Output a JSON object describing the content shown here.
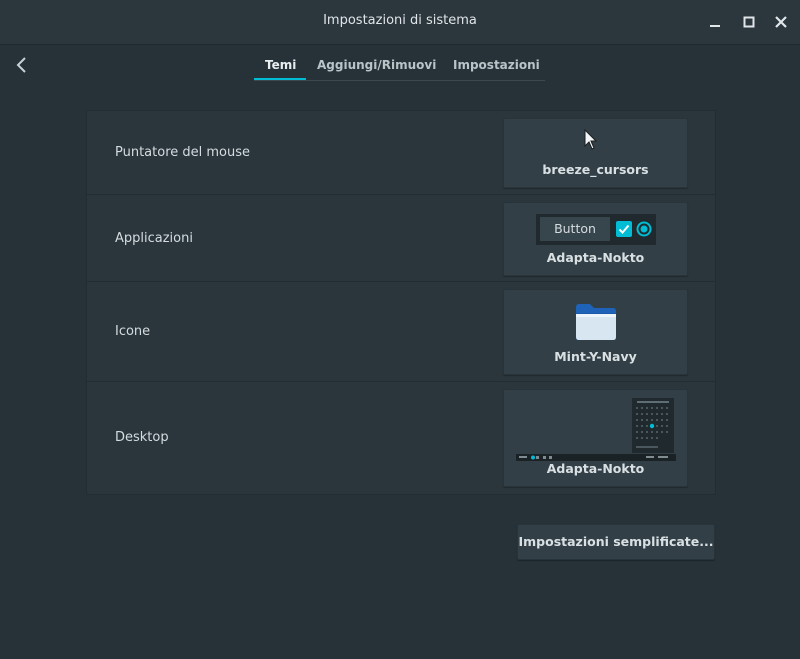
{
  "window": {
    "title": "Impostazioni di sistema",
    "controls": [
      "minimize-icon",
      "maximize-icon",
      "close-icon"
    ]
  },
  "nav": {
    "back_icon": "chevron-left-icon"
  },
  "tabs": [
    {
      "label": "Temi",
      "active": true
    },
    {
      "label": "Aggiungi/Rimuovi",
      "active": false
    },
    {
      "label": "Impostazioni",
      "active": false
    }
  ],
  "themes": {
    "mouse": {
      "label": "Puntatore del mouse",
      "value": "breeze_cursors",
      "icon": "cursor-arrow-icon"
    },
    "applications": {
      "label": "Applicazioni",
      "value": "Adapta-Nokto",
      "preview_button": "Button"
    },
    "icons": {
      "label": "Icone",
      "value": "Mint-Y-Navy",
      "icon": "folder-icon"
    },
    "desktop": {
      "label": "Desktop",
      "value": "Adapta-Nokto"
    }
  },
  "simple_settings_button": "Impostazioni semplificate...",
  "colors": {
    "accent": "#00bcd4",
    "background": "#263238",
    "panel": "#2a363c",
    "chooser": "#323f46"
  }
}
